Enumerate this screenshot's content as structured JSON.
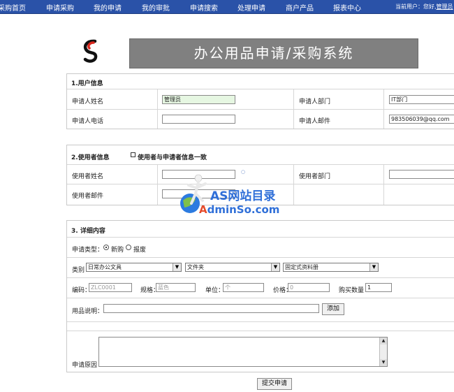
{
  "nav": {
    "items": [
      "采购首页",
      "申请采购",
      "我的申请",
      "我的审批",
      "申请搜索",
      "处理申请",
      "商户产品",
      "报表中心"
    ],
    "user_prefix": "当前用户：您好,",
    "user_name": "管理员"
  },
  "header": {
    "title": "办公用品申请/采购系统"
  },
  "section1": {
    "title": "1.用户信息",
    "applicant_name_label": "申请人姓名",
    "applicant_name_value": "管理员",
    "applicant_dept_label": "申请人部门",
    "applicant_dept_value": "IT部门",
    "applicant_phone_label": "申请人电话",
    "applicant_phone_value": "",
    "applicant_email_label": "申请人邮件",
    "applicant_email_value": "983506039@qq.com"
  },
  "section2": {
    "title": "2.使用者信息",
    "same_as_applicant_label": "使用者与申请者信息一致",
    "user_name_label": "使用者姓名",
    "user_dept_label": "使用者部门",
    "user_email_label": "使用者邮件"
  },
  "section3": {
    "title": "3. 详细内容",
    "type_label": "申请类型：",
    "type_options": [
      "新购",
      "报废"
    ],
    "category_label": "类别",
    "category1": "日常办公文具",
    "category2": "文件夹",
    "category3": "固定式资料册",
    "code_label": "编码：",
    "code_placeholder": "ZLC0001",
    "spec_label": "规格：",
    "spec_placeholder": "蓝色",
    "unit_label": "单位：",
    "unit_placeholder": "个",
    "price_label": "价格：",
    "price_placeholder": "0",
    "qty_label": "购买数量",
    "qty_value": "1",
    "desc_label": "用品说明：",
    "add_button": "添加",
    "reason_label": "申请原因"
  },
  "submit_button": "提交申请",
  "watermark": {
    "line1": "AS网站目录",
    "line2a": "A",
    "line2b": "dminSo.com"
  },
  "colors": {
    "nav_bg": "#2a52a8",
    "banner_bg": "#808080",
    "highlight_input": "#e6f7e2",
    "watermark_blue": "#2f6fd8",
    "watermark_red": "#e54a2a"
  }
}
